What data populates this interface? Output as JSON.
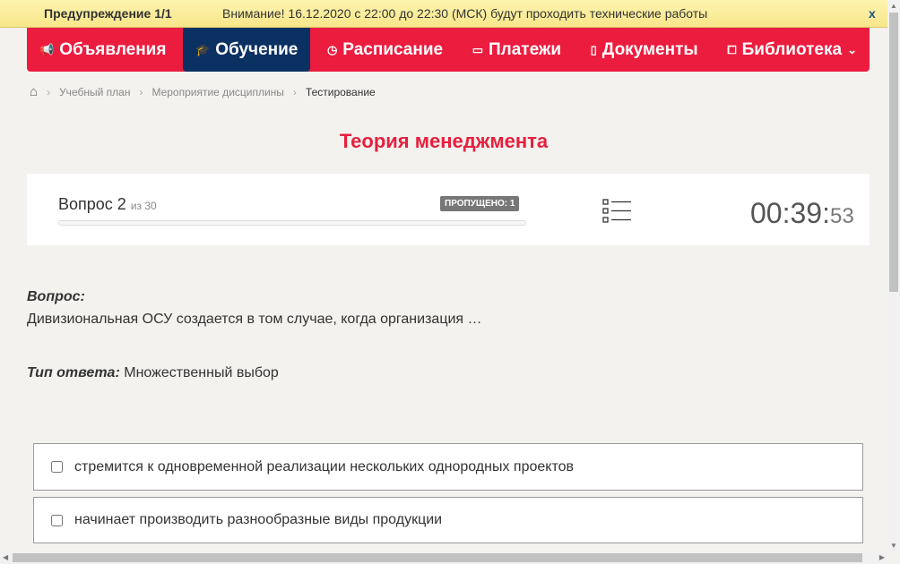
{
  "warning": {
    "title": "Предупреждение 1/1",
    "message": "Внимание! 16.12.2020 с 22:00 до 22:30 (МСК) будут проходить технические работы",
    "close": "x"
  },
  "nav": [
    {
      "label": "Объявления",
      "icon": "megaphone-icon"
    },
    {
      "label": "Обучение",
      "icon": "graduation-cap-icon",
      "active": true
    },
    {
      "label": "Расписание",
      "icon": "clock-icon"
    },
    {
      "label": "Платежи",
      "icon": "money-icon"
    },
    {
      "label": "Документы",
      "icon": "document-icon"
    },
    {
      "label": "Библиотека",
      "icon": "book-icon"
    }
  ],
  "breadcrumb": [
    "Учебный план",
    "Мероприятие дисциплины",
    "Тестирование"
  ],
  "title": "Теория менеджмента",
  "progress": {
    "question": "Вопрос 2",
    "of": "из 30",
    "skipped": "ПРОПУЩЕНО: 1",
    "percent": 0
  },
  "timer": {
    "main": "00:39:",
    "seconds": "53"
  },
  "question": {
    "label": "Вопрос:",
    "text": "Дивизиональная ОСУ создается в том случае, когда организация …",
    "type_label": "Тип ответа:",
    "type_value": "Множественный выбор"
  },
  "options": [
    "стремится к одновременной реализации нескольких однородных проектов",
    "начинает производить разнообразные виды продукции"
  ],
  "colors": {
    "brand": "#ec1c3f",
    "active": "#0b3163"
  }
}
